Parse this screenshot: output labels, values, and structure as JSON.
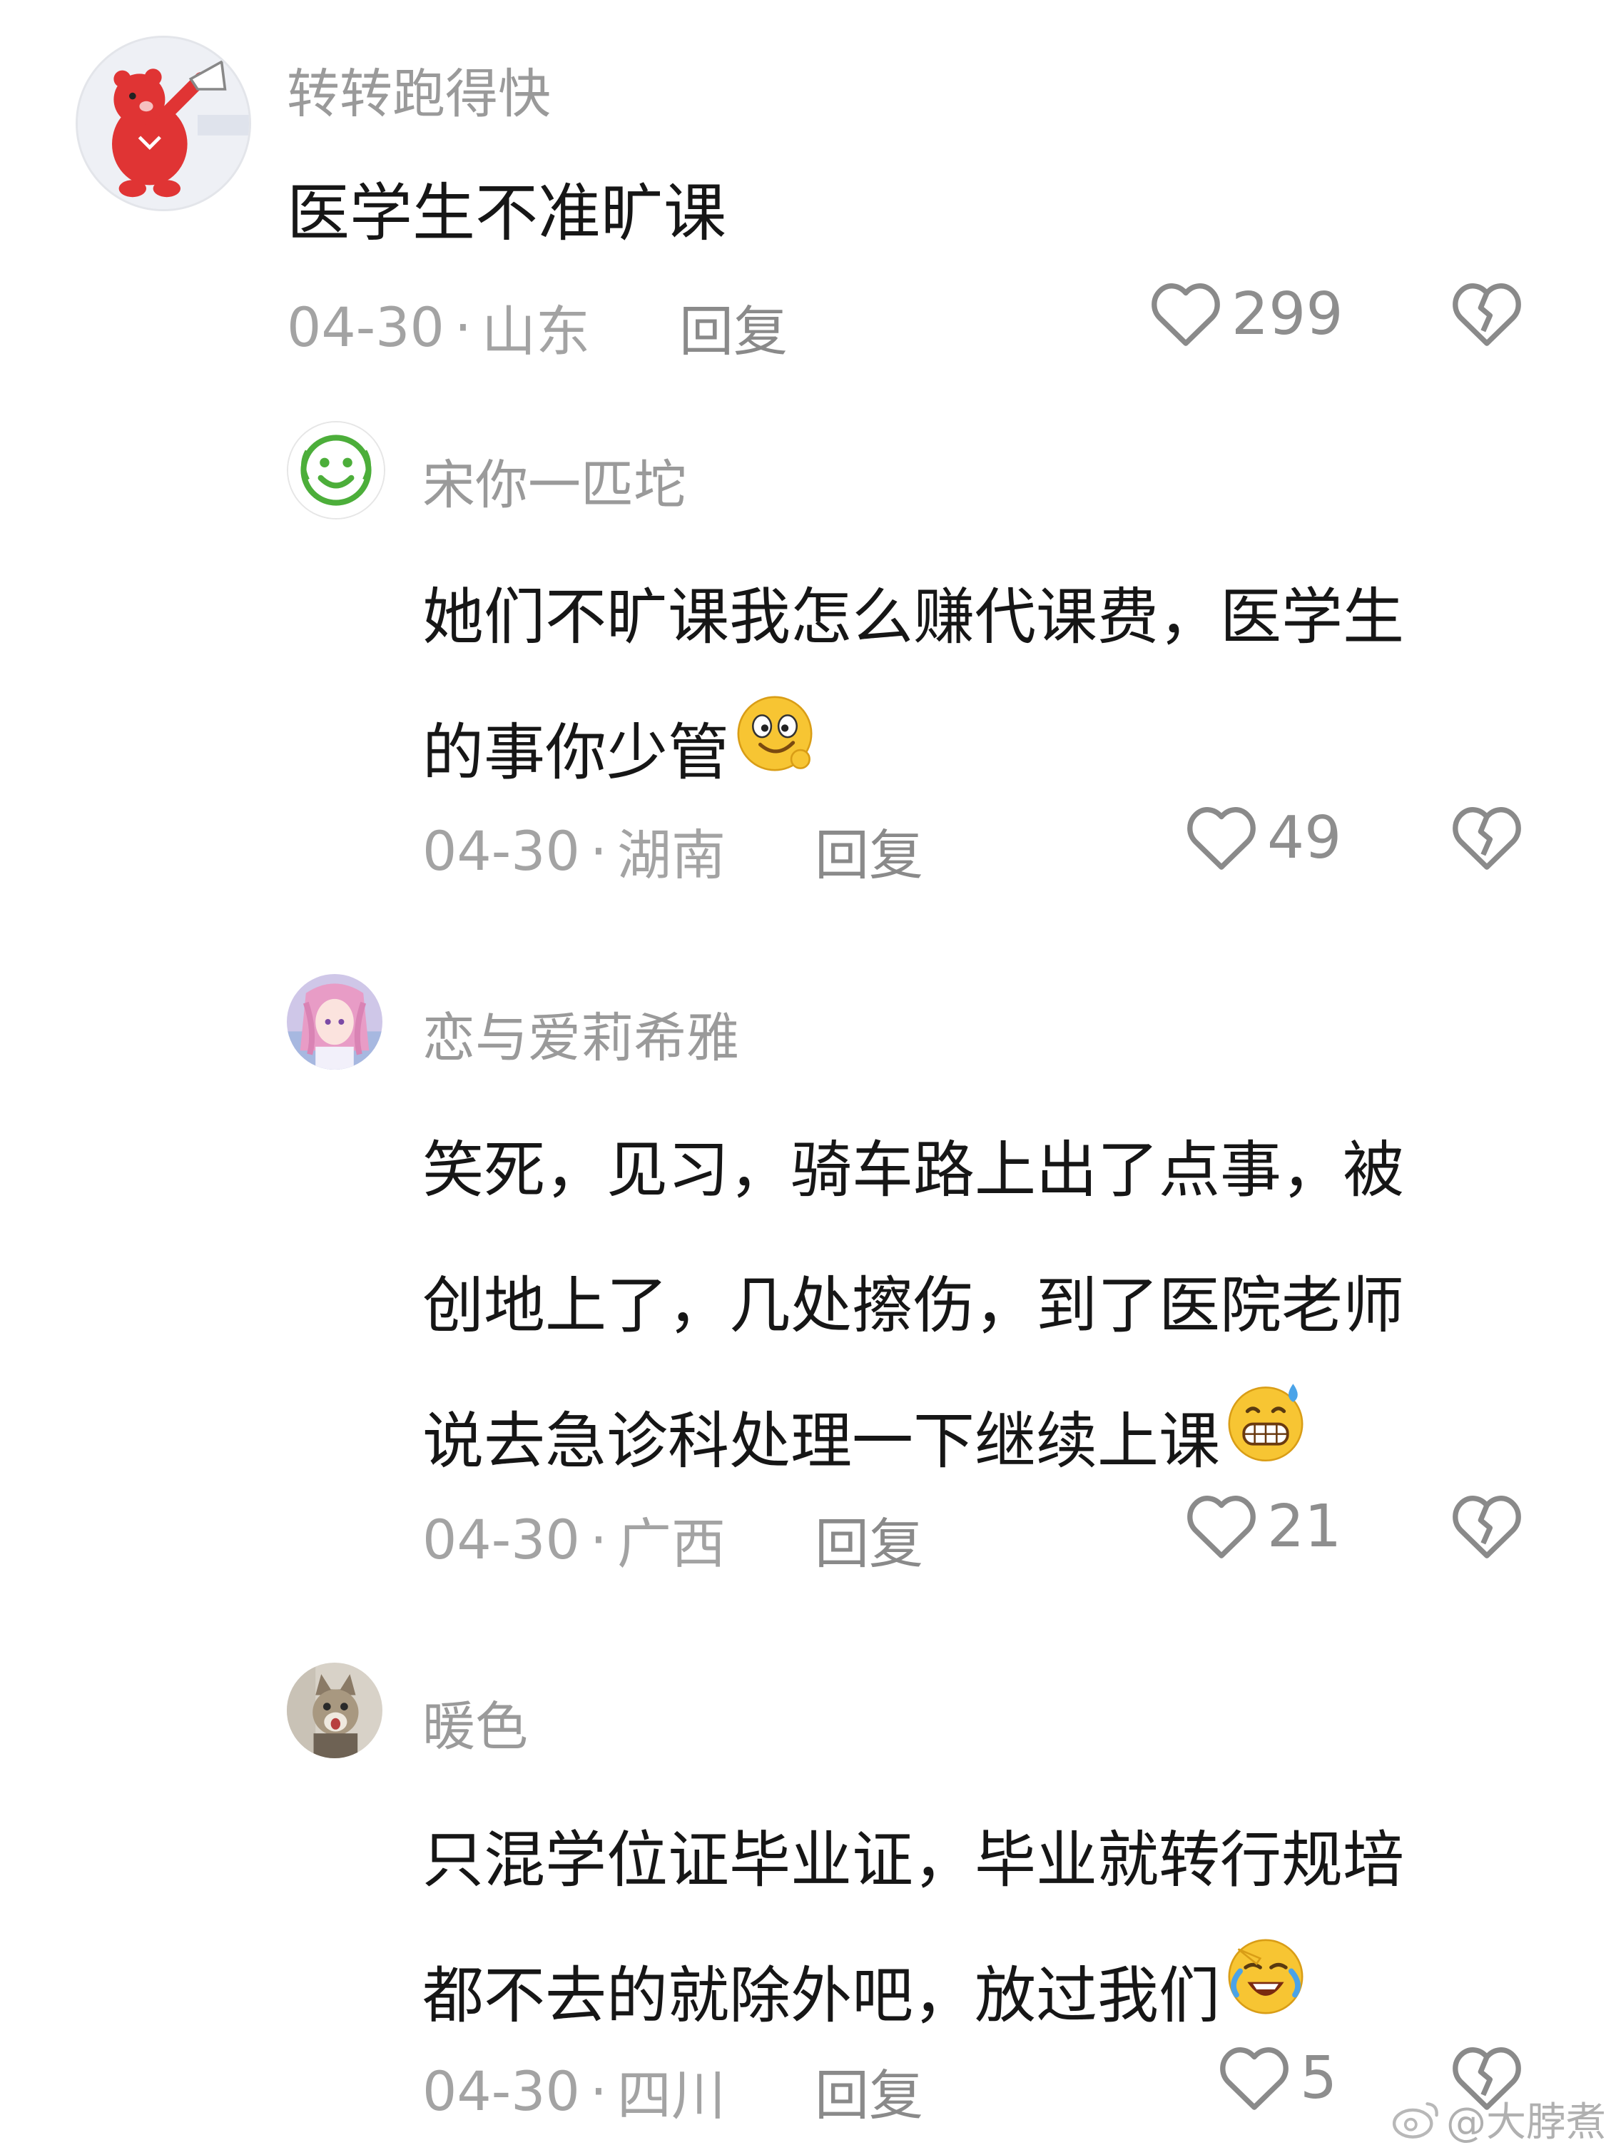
{
  "comments": [
    {
      "username": "转转跑得快",
      "lines": [
        "医学生不准旷课"
      ],
      "date": "04-30",
      "separator": "·",
      "location": "山东",
      "reply_label": "回复",
      "likes": "299",
      "avatar_icon": "red-bear-megaphone-avatar"
    },
    {
      "username": "宋你一匹坨",
      "lines": [
        "她们不旷课我怎么赚代课费，医学生",
        "的事你少管"
      ],
      "emoji": "wink-face-emoji",
      "date": "04-30",
      "separator": "·",
      "location": "湖南",
      "reply_label": "回复",
      "likes": "49",
      "avatar_icon": "green-smiley-avatar"
    },
    {
      "username": "恋与爱莉希雅",
      "lines": [
        "笑死，见习，骑车路上出了点事，被",
        "创地上了，几处擦伤，到了医院老师",
        "说去急诊科处理一下继续上课"
      ],
      "emoji": "grimace-sweat-emoji",
      "date": "04-30",
      "separator": "·",
      "location": "广西",
      "reply_label": "回复",
      "likes": "21",
      "avatar_icon": "anime-girl-avatar"
    },
    {
      "username": "暖色",
      "lines": [
        "只混学位证毕业证，毕业就转行规培",
        "都不去的就除外吧，放过我们"
      ],
      "emoji": "crying-laugh-emoji",
      "date": "04-30",
      "separator": "·",
      "location": "四川",
      "reply_label": "回复",
      "likes": "5",
      "avatar_icon": "cat-photo-avatar"
    }
  ],
  "watermark": {
    "text": "@大脖煮",
    "icon": "weibo-logo-icon"
  },
  "colors": {
    "username": "#9a9a9a",
    "text": "#161616",
    "meta": "#a3a3a3",
    "icon": "#8a8a8a"
  }
}
